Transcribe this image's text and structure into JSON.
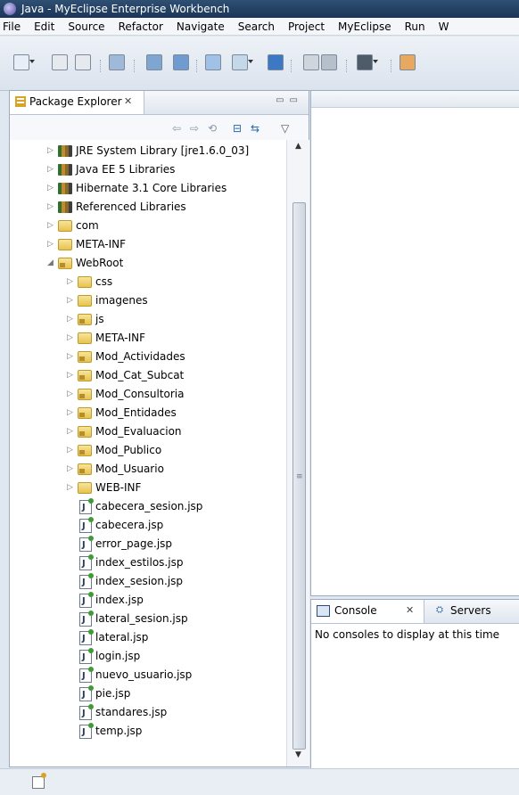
{
  "window": {
    "title": "Java - MyEclipse Enterprise Workbench"
  },
  "menubar": [
    "File",
    "Edit",
    "Source",
    "Refactor",
    "Navigate",
    "Search",
    "Project",
    "MyEclipse",
    "Run",
    "W"
  ],
  "toolbar": {
    "icons": [
      "new-wizard-icon",
      "save-icon",
      "print-icon",
      "server-manager-icon",
      "deploy-project-icon",
      "run-server-icon",
      "new-web-project-icon",
      "new-jsp-icon",
      "open-browser-icon",
      "build-icon",
      "refresh-icon",
      "image-editor-icon",
      "plugin-icon"
    ]
  },
  "package_explorer": {
    "tab_label": "Package Explorer",
    "close_glyph": "✕",
    "tree": [
      {
        "label": "JRE System Library [jre1.6.0_03]",
        "type": "lib",
        "indent": 0,
        "expand": "collapsed"
      },
      {
        "label": "Java EE 5 Libraries",
        "type": "lib",
        "indent": 0,
        "expand": "collapsed"
      },
      {
        "label": "Hibernate 3.1 Core Libraries",
        "type": "lib",
        "indent": 0,
        "expand": "collapsed"
      },
      {
        "label": "Referenced Libraries",
        "type": "lib",
        "indent": 0,
        "expand": "collapsed"
      },
      {
        "label": "com",
        "type": "folder",
        "indent": 0,
        "expand": "collapsed"
      },
      {
        "label": "META-INF",
        "type": "folder",
        "indent": 0,
        "expand": "collapsed"
      },
      {
        "label": "WebRoot",
        "type": "pfolder",
        "indent": 0,
        "expand": "expanded"
      },
      {
        "label": "css",
        "type": "folder",
        "indent": 1,
        "expand": "collapsed"
      },
      {
        "label": "imagenes",
        "type": "folder",
        "indent": 1,
        "expand": "collapsed"
      },
      {
        "label": "js",
        "type": "pfolder",
        "indent": 1,
        "expand": "collapsed"
      },
      {
        "label": "META-INF",
        "type": "folder",
        "indent": 1,
        "expand": "collapsed"
      },
      {
        "label": "Mod_Actividades",
        "type": "pfolder",
        "indent": 1,
        "expand": "collapsed"
      },
      {
        "label": "Mod_Cat_Subcat",
        "type": "pfolder",
        "indent": 1,
        "expand": "collapsed"
      },
      {
        "label": "Mod_Consultoria",
        "type": "pfolder",
        "indent": 1,
        "expand": "collapsed"
      },
      {
        "label": "Mod_Entidades",
        "type": "pfolder",
        "indent": 1,
        "expand": "collapsed"
      },
      {
        "label": "Mod_Evaluacion",
        "type": "pfolder",
        "indent": 1,
        "expand": "collapsed"
      },
      {
        "label": "Mod_Publico",
        "type": "pfolder",
        "indent": 1,
        "expand": "collapsed"
      },
      {
        "label": "Mod_Usuario",
        "type": "pfolder",
        "indent": 1,
        "expand": "collapsed"
      },
      {
        "label": "WEB-INF",
        "type": "folder",
        "indent": 1,
        "expand": "collapsed"
      },
      {
        "label": "cabecera_sesion.jsp",
        "type": "jsp",
        "indent": 1,
        "expand": "none"
      },
      {
        "label": "cabecera.jsp",
        "type": "jsp",
        "indent": 1,
        "expand": "none"
      },
      {
        "label": "error_page.jsp",
        "type": "jsp",
        "indent": 1,
        "expand": "none"
      },
      {
        "label": "index_estilos.jsp",
        "type": "jsp",
        "indent": 1,
        "expand": "none"
      },
      {
        "label": "index_sesion.jsp",
        "type": "jsp",
        "indent": 1,
        "expand": "none"
      },
      {
        "label": "index.jsp",
        "type": "jsp",
        "indent": 1,
        "expand": "none"
      },
      {
        "label": "lateral_sesion.jsp",
        "type": "jsp",
        "indent": 1,
        "expand": "none"
      },
      {
        "label": "lateral.jsp",
        "type": "jsp",
        "indent": 1,
        "expand": "none"
      },
      {
        "label": "login.jsp",
        "type": "jsp",
        "indent": 1,
        "expand": "none"
      },
      {
        "label": "nuevo_usuario.jsp",
        "type": "jsp",
        "indent": 1,
        "expand": "none"
      },
      {
        "label": "pie.jsp",
        "type": "jsp",
        "indent": 1,
        "expand": "none"
      },
      {
        "label": "standares.jsp",
        "type": "jsp",
        "indent": 1,
        "expand": "none"
      },
      {
        "label": "temp.jsp",
        "type": "jsp",
        "indent": 1,
        "expand": "none"
      }
    ]
  },
  "console": {
    "tab_console": "Console",
    "tab_servers": "Servers",
    "message": "No consoles to display at this time"
  }
}
